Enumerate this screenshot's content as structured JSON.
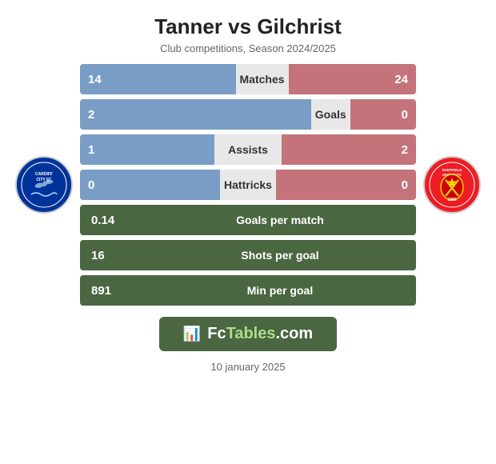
{
  "header": {
    "title": "Tanner vs Gilchrist",
    "subtitle": "Club competitions, Season 2024/2025"
  },
  "stats": {
    "matches": {
      "label": "Matches",
      "left": "14",
      "right": "24",
      "leftPct": 37,
      "rightPct": 63
    },
    "goals": {
      "label": "Goals",
      "left": "2",
      "right": "0",
      "leftPct": 80,
      "rightPct": 20
    },
    "assists": {
      "label": "Assists",
      "left": "1",
      "right": "2",
      "leftPct": 45,
      "rightPct": 45
    },
    "hattricks": {
      "label": "Hattricks",
      "left": "0",
      "right": "0",
      "leftPct": 50,
      "rightPct": 50
    }
  },
  "single_stats": {
    "gpm": {
      "label": "Goals per match",
      "value": "0.14"
    },
    "spg": {
      "label": "Shots per goal",
      "value": "16"
    },
    "mpg": {
      "label": "Min per goal",
      "value": "891"
    }
  },
  "logos": {
    "left": {
      "name": "Cardiff City FC",
      "year": ""
    },
    "right": {
      "name": "Sheffield United FC",
      "year": "1889"
    }
  },
  "branding": {
    "fctables": "FcTables.com"
  },
  "footer": {
    "date": "10 january 2025"
  }
}
